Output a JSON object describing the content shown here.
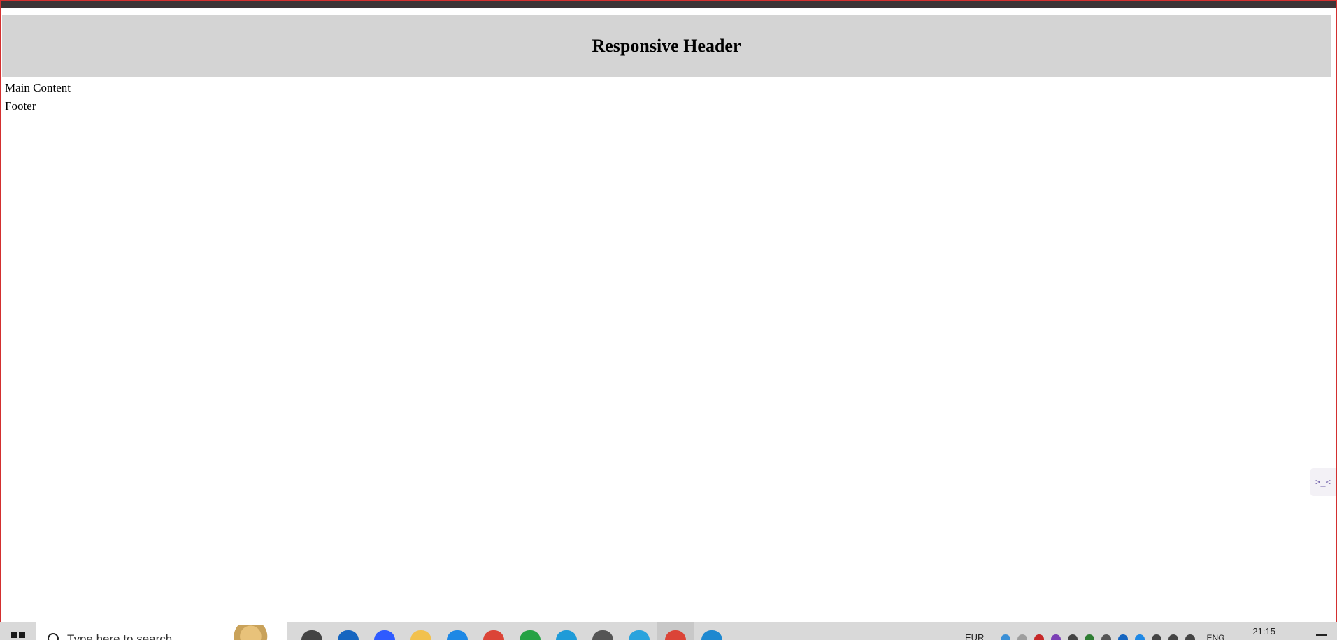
{
  "page": {
    "header_title": "Responsive Header",
    "main_content": "Main Content",
    "footer": "Footer"
  },
  "taskbar": {
    "search_placeholder": "Type here to search",
    "currency": "EUR",
    "language": "ENG",
    "time": "21:15",
    "apps": [
      {
        "name": "task-view-icon",
        "color": "#444444"
      },
      {
        "name": "mail-icon",
        "color": "#1565c0"
      },
      {
        "name": "app-icon",
        "color": "#2f5bff"
      },
      {
        "name": "file-explorer-icon",
        "color": "#f2c14e"
      },
      {
        "name": "search-app-icon",
        "color": "#1e88e5"
      },
      {
        "name": "chrome-icon",
        "color": "#db4437"
      },
      {
        "name": "whatsapp-icon",
        "color": "#25a244"
      },
      {
        "name": "edge-icon",
        "color": "#1f9bd8"
      },
      {
        "name": "clock-app-icon",
        "color": "#555555"
      },
      {
        "name": "telegram-icon",
        "color": "#2aa3dd"
      },
      {
        "name": "chrome-active-icon",
        "color": "#db4437"
      },
      {
        "name": "vscode-icon",
        "color": "#1e88d0"
      }
    ]
  },
  "colors": {
    "header_bg": "#d4d4d4",
    "frame_border": "#d32f2f",
    "taskbar_bg": "#d9d9d9"
  }
}
